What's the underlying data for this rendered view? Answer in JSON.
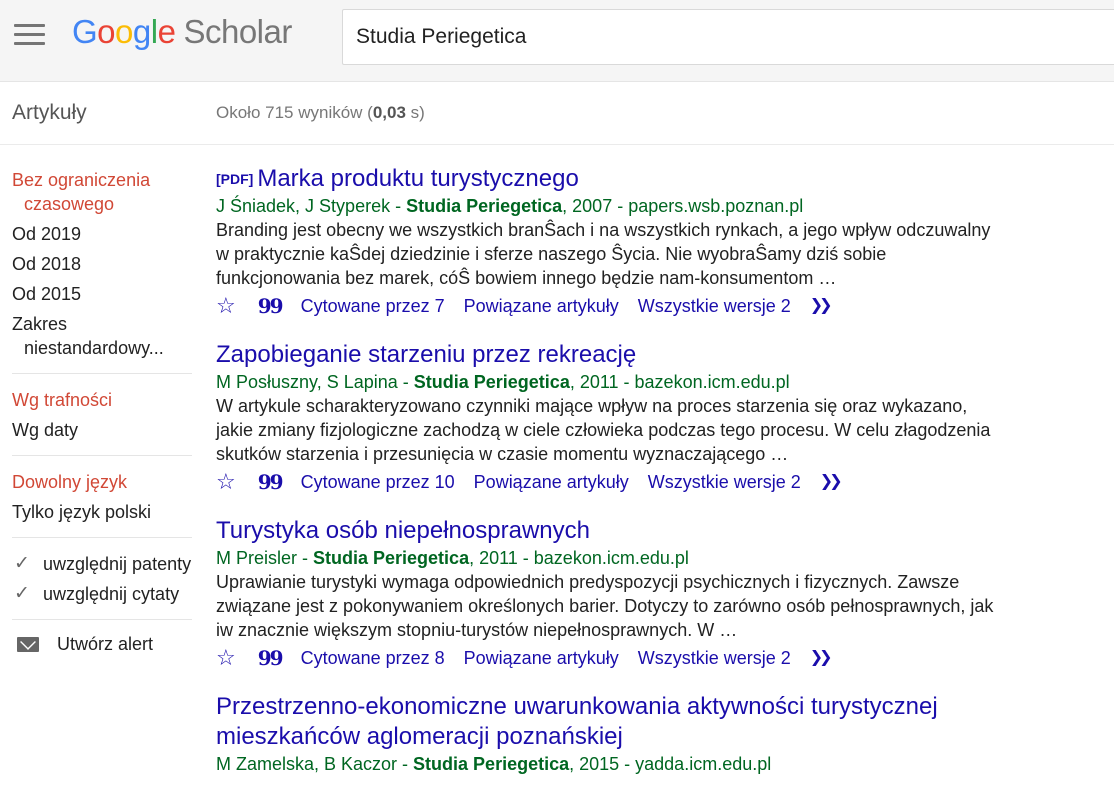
{
  "header": {
    "logo_letters": [
      "G",
      "o",
      "o",
      "g",
      "l",
      "e"
    ],
    "logo_suffix": "Scholar",
    "search_value": "Studia Periegetica"
  },
  "subheader": {
    "section": "Artykuły",
    "count_prefix": "Około 715 wyników (",
    "count_time": "0,03",
    "count_suffix": " s)"
  },
  "sidebar": {
    "time_any_line1": "Bez ograniczenia",
    "time_any_line2": "czasowego",
    "since_2019": "Od 2019",
    "since_2018": "Od 2018",
    "since_2015": "Od 2015",
    "custom_line1": "Zakres",
    "custom_line2": "niestandardowy...",
    "sort_relevance": "Wg trafności",
    "sort_date": "Wg daty",
    "lang_any": "Dowolny język",
    "lang_polish": "Tylko język polski",
    "include_patents": "uwzględnij patenty",
    "include_citations": "uwzględnij cytaty",
    "create_alert": "Utwórz alert"
  },
  "results": [
    {
      "pdf": "[PDF]",
      "title": "Marka produktu turystycznego",
      "authors": "J Śniadek, J Styperek - ",
      "journal": "Studia Periegetica",
      "source": ", 2007 - papers.wsb.poznan.pl",
      "snippet": "Branding jest obecny we wszystkich branŜach i na wszystkich rynkach, a jego wpływ odczuwalny w praktycznie kaŜdej dziedzinie i sferze naszego Ŝycia. Nie wyobraŜamy dziś sobie funkcjonowania bez marek, cóŜ bowiem innego będzie nam-konsumentom …",
      "cited": "Cytowane przez 7",
      "related": "Powiązane artykuły",
      "versions": "Wszystkie wersje 2"
    },
    {
      "pdf": "",
      "title": "Zapobieganie starzeniu przez rekreację",
      "authors": "M Posłuszny, S Lapina - ",
      "journal": "Studia Periegetica",
      "source": ", 2011 - bazekon.icm.edu.pl",
      "snippet": "W artykule scharakteryzowano czynniki mające wpływ na proces starzenia się oraz wykazano, jakie zmiany fizjologiczne zachodzą w ciele człowieka podczas tego procesu. W celu złagodzenia skutków starzenia i przesunięcia w czasie momentu wyznaczającego …",
      "cited": "Cytowane przez 10",
      "related": "Powiązane artykuły",
      "versions": "Wszystkie wersje 2"
    },
    {
      "pdf": "",
      "title": "Turystyka osób niepełnosprawnych",
      "authors": "M Preisler - ",
      "journal": "Studia Periegetica",
      "source": ", 2011 - bazekon.icm.edu.pl",
      "snippet": "Uprawianie turystyki wymaga odpowiednich predyspozycji psychicznych i fizycznych. Zawsze związane jest z pokonywaniem określonych barier. Dotyczy to zarówno osób pełnosprawnych, jak iw znacznie większym stopniu-turystów niepełnosprawnych. W …",
      "cited": "Cytowane przez 8",
      "related": "Powiązane artykuły",
      "versions": "Wszystkie wersje 2"
    },
    {
      "pdf": "",
      "title": "Przestrzenno-ekonomiczne uwarunkowania aktywności turystycznej mieszkańców aglomeracji poznańskiej",
      "authors": "M Zamelska, B Kaczor - ",
      "journal": "Studia Periegetica",
      "source": ", 2015 - yadda.icm.edu.pl",
      "snippet": "",
      "cited": "",
      "related": "",
      "versions": ""
    }
  ]
}
